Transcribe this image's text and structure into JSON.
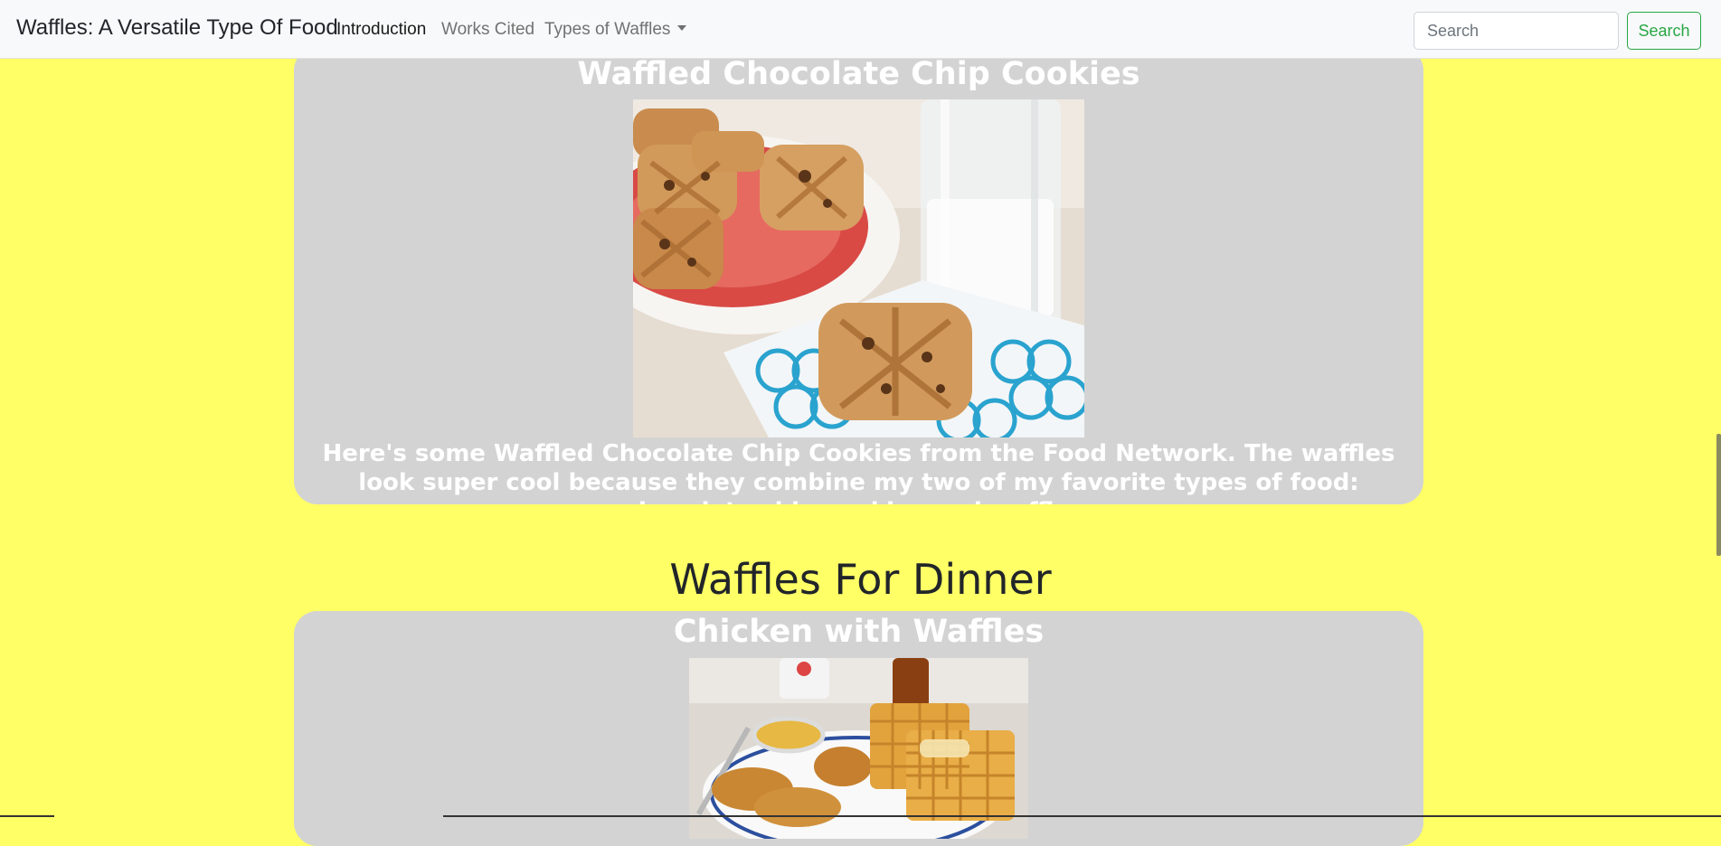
{
  "navbar": {
    "brand": "Waffles: A Versatile Type Of Food",
    "links": [
      {
        "label": "Introduction",
        "active": true
      },
      {
        "label": "Works Cited",
        "active": false
      },
      {
        "label": "Types of Waffles",
        "active": false,
        "dropdown": true
      }
    ],
    "search": {
      "placeholder": "Search",
      "button_label": "Search"
    }
  },
  "cards": [
    {
      "title": "Waffled Chocolate Chip Cookies",
      "image_icon": "waffle-cookies-photo",
      "text": "Here's some Waffled Chocolate Chip Cookies from the Food Network. The waffles look super cool because they combine my two of my favorite types of food: chocolate chip cookies and waffles."
    },
    {
      "title": "Chicken with Waffles",
      "image_icon": "chicken-waffles-photo"
    }
  ],
  "section": {
    "heading": "Waffles For Dinner"
  },
  "colors": {
    "page_background": "#ffff66",
    "card_background": "#d3d3d3",
    "card_text": "#ffffff",
    "search_accent": "#28a745"
  }
}
